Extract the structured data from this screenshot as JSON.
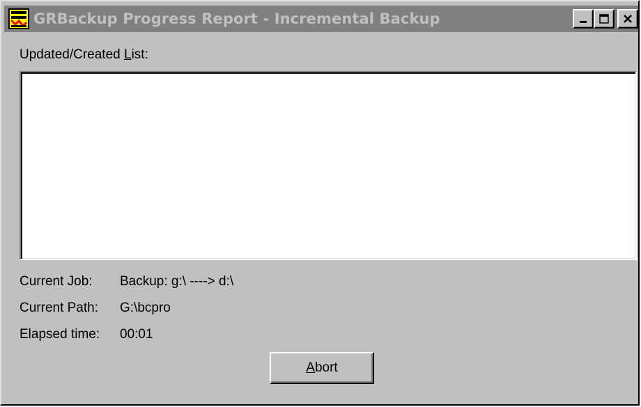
{
  "window": {
    "title": "GRBackup Progress Report - Incremental Backup",
    "icon": "grbackup-app-icon",
    "controls": {
      "minimize_icon": "minimize-icon",
      "maximize_icon": "maximize-icon",
      "close_icon": "close-icon"
    }
  },
  "list": {
    "label_prefix": "Updated/Created ",
    "label_mnemonic": "L",
    "label_suffix": "ist:",
    "items": []
  },
  "info": {
    "job_label": "Current Job:",
    "job_value": "Backup: g:\\ ----> d:\\",
    "path_label": "Current Path:",
    "path_value": "G:\\bcpro",
    "elapsed_label": "Elapsed time:",
    "elapsed_value": "00:01"
  },
  "abort_button": {
    "mnemonic": "A",
    "rest": "bort"
  },
  "colors": {
    "face": "#c0c0c0",
    "title_inactive": "#808080",
    "title_text": "#c0c0c0",
    "list_bg": "#ffffff"
  }
}
